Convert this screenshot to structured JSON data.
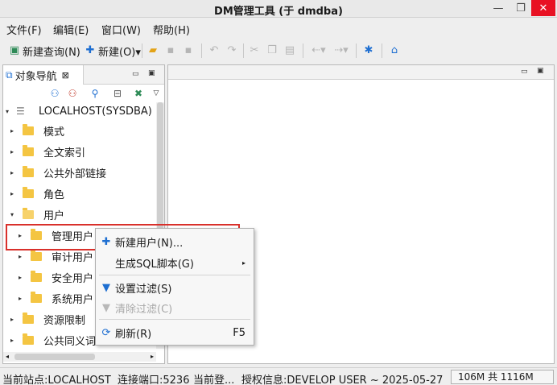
{
  "window": {
    "title": "DM管理工具 (于 dmdba)",
    "minimize": "—",
    "restore": "❐",
    "close": "✕"
  },
  "menu": [
    "文件(F)",
    "编辑(E)",
    "窗口(W)",
    "帮助(H)"
  ],
  "toolbar": {
    "new_query": "新建查询(N)",
    "new": "新建(O)▾"
  },
  "navigator": {
    "tab_label": "对象导航",
    "tab_close": "⊠"
  },
  "tree": {
    "root": "LOCALHOST(SYSDBA)",
    "items": [
      {
        "label": "模式"
      },
      {
        "label": "全文索引"
      },
      {
        "label": "公共外部链接"
      },
      {
        "label": "角色"
      },
      {
        "label": "用户"
      },
      {
        "label": "管理用户"
      },
      {
        "label": "审计用户"
      },
      {
        "label": "安全用户"
      },
      {
        "label": "系统用户"
      },
      {
        "label": "资源限制"
      },
      {
        "label": "公共同义词"
      }
    ]
  },
  "context_menu": {
    "new_user": "新建用户(N)...",
    "gen_sql": "生成SQL脚本(G)",
    "set_filter": "设置过滤(S)",
    "clear_filter": "清除过滤(C)",
    "refresh": "刷新(R)",
    "refresh_shortcut": "F5"
  },
  "status": {
    "site": "当前站点:LOCALHOST",
    "port": "连接端口:5236",
    "login": "当前登...",
    "license": "授权信息:DEVELOP USER ~ 2025-05-27",
    "memory": "106M 共 1116M"
  },
  "colors": {
    "accent": "#1f6fd1",
    "highlight": "#d9302b",
    "folder": "#f4c542"
  }
}
